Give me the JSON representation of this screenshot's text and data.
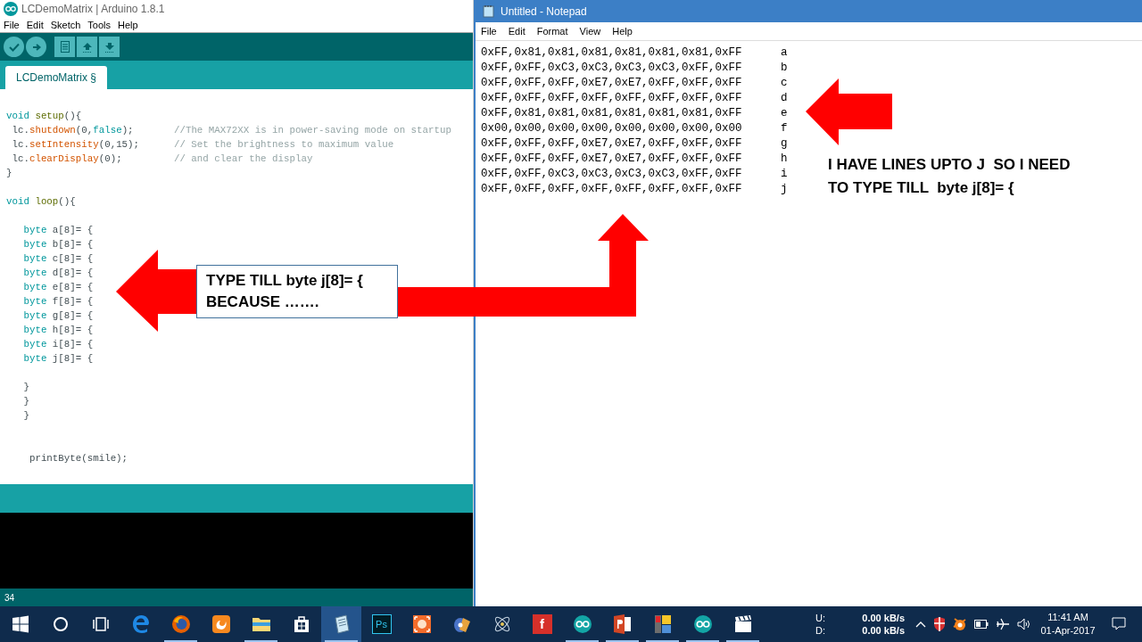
{
  "arduino": {
    "title": "LCDemoMatrix | Arduino 1.8.1",
    "menu": [
      "File",
      "Edit",
      "Sketch",
      "Tools",
      "Help"
    ],
    "tab": {
      "label": "LCDemoMatrix §",
      "selected": true
    },
    "code": [
      {
        "kind": "blank"
      },
      {
        "kind": "code",
        "segments": [
          {
            "text": "void",
            "kind": "keyword"
          },
          {
            "text": " setup",
            "kind": "method"
          },
          {
            "text": "(){",
            "kind": "plain"
          }
        ]
      },
      {
        "kind": "code",
        "segments": [
          {
            "text": " lc.",
            "kind": "plain"
          },
          {
            "text": "shutdown",
            "kind": "function"
          },
          {
            "text": "(0,",
            "kind": "plain"
          },
          {
            "text": "false",
            "kind": "keyword"
          },
          {
            "text": ");",
            "kind": "plain"
          },
          {
            "text": "       //The MAX72XX is in power-saving mode on startup",
            "kind": "comment"
          }
        ]
      },
      {
        "kind": "code",
        "segments": [
          {
            "text": " lc.",
            "kind": "plain"
          },
          {
            "text": "setIntensity",
            "kind": "function"
          },
          {
            "text": "(0,15);",
            "kind": "plain"
          },
          {
            "text": "      // Set the brightness to maximum value",
            "kind": "comment"
          }
        ]
      },
      {
        "kind": "code",
        "segments": [
          {
            "text": " lc.",
            "kind": "plain"
          },
          {
            "text": "clearDisplay",
            "kind": "function"
          },
          {
            "text": "(0);",
            "kind": "plain"
          },
          {
            "text": "         // and clear the display",
            "kind": "comment"
          }
        ]
      },
      {
        "kind": "code",
        "segments": [
          {
            "text": "}",
            "kind": "plain"
          }
        ]
      },
      {
        "kind": "blank"
      },
      {
        "kind": "code",
        "segments": [
          {
            "text": "void",
            "kind": "keyword"
          },
          {
            "text": " loop",
            "kind": "method"
          },
          {
            "text": "(){",
            "kind": "plain"
          }
        ]
      },
      {
        "kind": "blank"
      },
      {
        "kind": "code",
        "segments": [
          {
            "text": "   byte",
            "kind": "keyword"
          },
          {
            "text": " a[8]= {",
            "kind": "plain"
          }
        ]
      },
      {
        "kind": "code",
        "segments": [
          {
            "text": "   byte",
            "kind": "keyword"
          },
          {
            "text": " b[8]= {",
            "kind": "plain"
          }
        ]
      },
      {
        "kind": "code",
        "segments": [
          {
            "text": "   byte",
            "kind": "keyword"
          },
          {
            "text": " c[8]= {",
            "kind": "plain"
          }
        ]
      },
      {
        "kind": "code",
        "segments": [
          {
            "text": "   byte",
            "kind": "keyword"
          },
          {
            "text": " d[8]= {",
            "kind": "plain"
          }
        ]
      },
      {
        "kind": "code",
        "segments": [
          {
            "text": "   byte",
            "kind": "keyword"
          },
          {
            "text": " e[8]= {",
            "kind": "plain"
          }
        ]
      },
      {
        "kind": "code",
        "segments": [
          {
            "text": "   byte",
            "kind": "keyword"
          },
          {
            "text": " f[8]= {",
            "kind": "plain"
          }
        ]
      },
      {
        "kind": "code",
        "segments": [
          {
            "text": "   byte",
            "kind": "keyword"
          },
          {
            "text": " g[8]= {",
            "kind": "plain"
          }
        ]
      },
      {
        "kind": "code",
        "segments": [
          {
            "text": "   byte",
            "kind": "keyword"
          },
          {
            "text": " h[8]= {",
            "kind": "plain"
          }
        ]
      },
      {
        "kind": "code",
        "segments": [
          {
            "text": "   byte",
            "kind": "keyword"
          },
          {
            "text": " i[8]= {",
            "kind": "plain"
          }
        ]
      },
      {
        "kind": "code",
        "segments": [
          {
            "text": "   byte",
            "kind": "keyword"
          },
          {
            "text": " j[8]= {",
            "kind": "plain"
          }
        ]
      },
      {
        "kind": "blank"
      },
      {
        "kind": "code",
        "segments": [
          {
            "text": "   }",
            "kind": "plain"
          }
        ]
      },
      {
        "kind": "code",
        "segments": [
          {
            "text": "   }",
            "kind": "plain"
          }
        ]
      },
      {
        "kind": "code",
        "segments": [
          {
            "text": "   }",
            "kind": "plain"
          }
        ]
      },
      {
        "kind": "blank"
      },
      {
        "kind": "blank"
      },
      {
        "kind": "code",
        "segments": [
          {
            "text": "    printByte(smile);",
            "kind": "plain"
          }
        ]
      }
    ],
    "status_line": "34"
  },
  "notepad": {
    "title": "Untitled - Notepad",
    "menu": [
      "File",
      "Edit",
      "Format",
      "View",
      "Help"
    ],
    "lines": [
      {
        "values": "0xFF,0x81,0x81,0x81,0x81,0x81,0x81,0xFF",
        "letter": "a"
      },
      {
        "values": "0xFF,0xFF,0xC3,0xC3,0xC3,0xC3,0xFF,0xFF",
        "letter": "b"
      },
      {
        "values": "0xFF,0xFF,0xFF,0xE7,0xE7,0xFF,0xFF,0xFF",
        "letter": "c"
      },
      {
        "values": "0xFF,0xFF,0xFF,0xFF,0xFF,0xFF,0xFF,0xFF",
        "letter": "d"
      },
      {
        "values": "0xFF,0x81,0x81,0x81,0x81,0x81,0x81,0xFF",
        "letter": "e"
      },
      {
        "values": "0x00,0x00,0x00,0x00,0x00,0x00,0x00,0x00",
        "letter": "f"
      },
      {
        "values": "0xFF,0xFF,0xFF,0xE7,0xE7,0xFF,0xFF,0xFF",
        "letter": "g"
      },
      {
        "values": "0xFF,0xFF,0xFF,0xE7,0xE7,0xFF,0xFF,0xFF",
        "letter": "h"
      },
      {
        "values": "0xFF,0xFF,0xC3,0xC3,0xC3,0xC3,0xFF,0xFF",
        "letter": "i"
      },
      {
        "values": "0xFF,0xFF,0xFF,0xFF,0xFF,0xFF,0xFF,0xFF",
        "letter": "j"
      }
    ]
  },
  "annotations": {
    "box_lines": [
      "TYPE TILL byte j[8]= {",
      "BECAUSE ……."
    ],
    "note_lines": [
      "I HAVE LINES UPTO J  SO I NEED",
      "TO TYPE TILL  byte j[8]= {"
    ]
  },
  "taskbar": {
    "apps": [
      {
        "kind": "start",
        "running": false,
        "selected": false
      },
      {
        "kind": "search",
        "running": false,
        "selected": false
      },
      {
        "kind": "taskview",
        "running": false,
        "selected": false
      },
      {
        "kind": "edge",
        "running": false,
        "selected": false
      },
      {
        "kind": "firefox",
        "running": true,
        "selected": false
      },
      {
        "kind": "uc",
        "running": false,
        "selected": false
      },
      {
        "kind": "explorer",
        "running": true,
        "selected": false
      },
      {
        "kind": "store",
        "running": false,
        "selected": false
      },
      {
        "kind": "notepad",
        "running": true,
        "selected": true
      },
      {
        "kind": "photoshop",
        "label": "Ps",
        "running": false,
        "selected": false
      },
      {
        "kind": "recorder",
        "running": false,
        "selected": false
      },
      {
        "kind": "video",
        "running": false,
        "selected": false
      },
      {
        "kind": "atom",
        "running": false,
        "selected": false
      },
      {
        "kind": "flash",
        "label": "f",
        "running": false,
        "selected": false
      },
      {
        "kind": "arduino",
        "running": true,
        "selected": false
      },
      {
        "kind": "powerpoint",
        "running": true,
        "selected": false
      },
      {
        "kind": "tiles",
        "running": true,
        "selected": false
      },
      {
        "kind": "arduino",
        "running": true,
        "selected": false
      },
      {
        "kind": "clapper",
        "running": true,
        "selected": false
      }
    ],
    "net": {
      "up_label": "U:",
      "up": "0.00 kB/s",
      "down_label": "D:",
      "down": "0.00 kB/s"
    },
    "time": "11:41 AM",
    "date": "01-Apr-2017"
  }
}
